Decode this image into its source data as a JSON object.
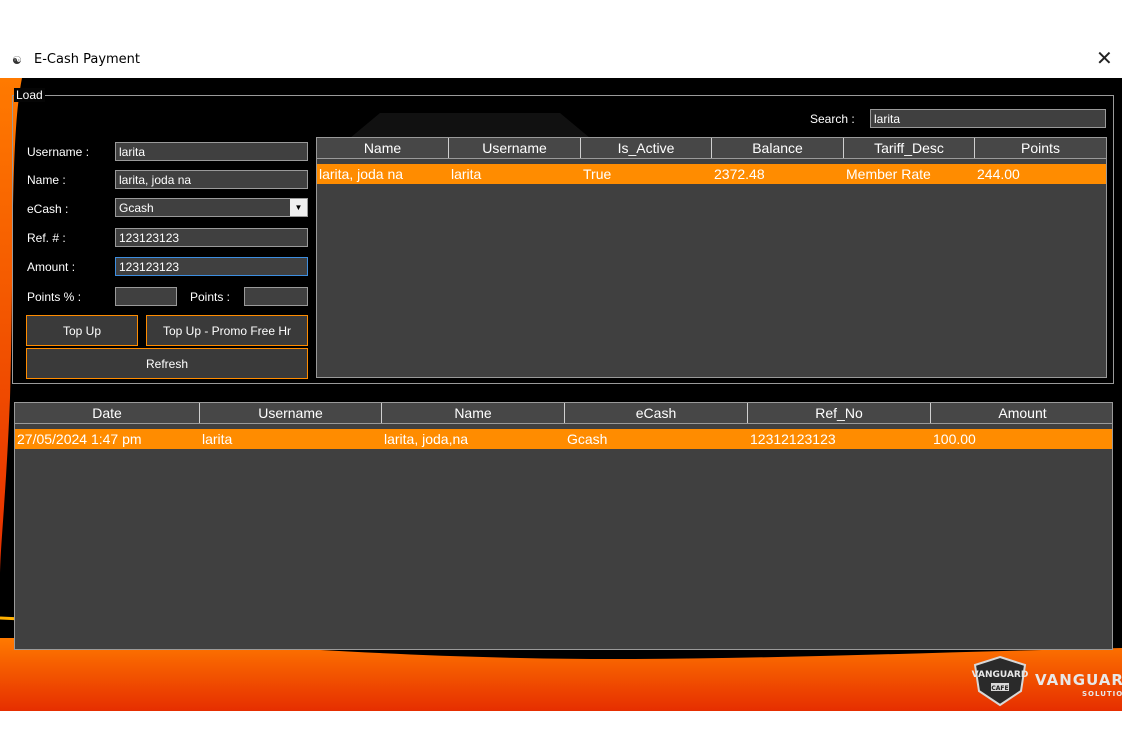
{
  "window": {
    "title": "E-Cash Payment",
    "close_glyph": "✕",
    "app_icon": "vanguard-shield-icon"
  },
  "load_group": {
    "legend": "Load",
    "search_label": "Search :",
    "search_value": "larita",
    "username_label": "Username :",
    "username_value": "larita",
    "name_label": "Name :",
    "name_value": "larita, joda na",
    "ecash_label": "eCash :",
    "ecash_value": "Gcash",
    "ref_label": "Ref. # :",
    "ref_value": "123123123",
    "amount_label": "Amount :",
    "amount_value": "123123123",
    "points_pct_label": "Points % :",
    "points_pct_value": "",
    "points_label": "Points :",
    "points_value": "",
    "topup_label": "Top Up",
    "topup_promo_label": "Top Up - Promo Free Hr",
    "refresh_label": "Refresh"
  },
  "members_grid": {
    "columns": [
      "Name",
      "Username",
      "Is_Active",
      "Balance",
      "Tariff_Desc",
      "Points"
    ],
    "rows": [
      [
        "larita, joda na",
        "larita",
        "True",
        "2372.48",
        "Member Rate",
        "244.00"
      ]
    ]
  },
  "transactions_grid": {
    "columns": [
      "Date",
      "Username",
      "Name",
      "eCash",
      "Ref_No",
      "Amount"
    ],
    "rows": [
      [
        "27/05/2024 1:47 pm",
        "larita",
        "larita, joda,na",
        "Gcash",
        "12312123123",
        "100.00"
      ]
    ]
  },
  "branding": {
    "emblem_text": "VANGUARD",
    "emblem_sub": "CAFE",
    "name": "VANGUARD",
    "sub": "SOLUTION"
  },
  "colors": {
    "accent": "#ff8c00",
    "grid_bg": "#404040",
    "window_bg": "#000000"
  }
}
